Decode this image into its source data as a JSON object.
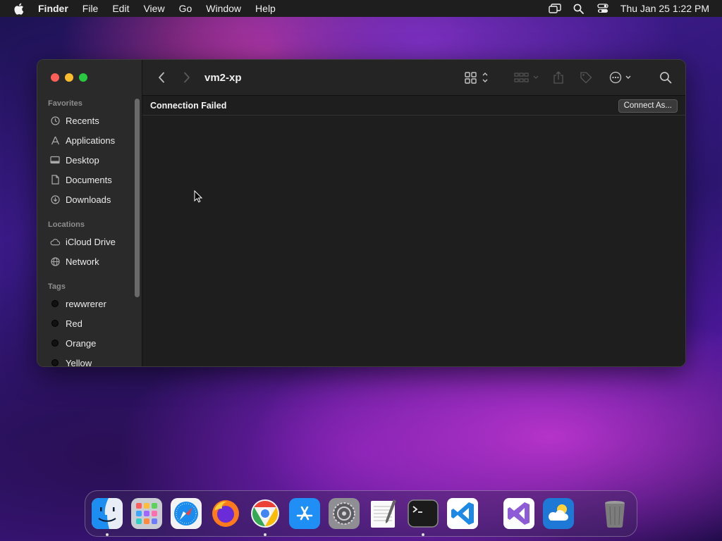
{
  "menubar": {
    "app_name": "Finder",
    "menus": [
      "File",
      "Edit",
      "View",
      "Go",
      "Window",
      "Help"
    ],
    "clock": "Thu Jan 25  1:22 PM"
  },
  "window": {
    "title": "vm2-xp",
    "banner_text": "Connection Failed",
    "connect_button": "Connect As..."
  },
  "sidebar": {
    "favorites_heading": "Favorites",
    "favorites": [
      {
        "label": "Recents",
        "icon": "clock-icon"
      },
      {
        "label": "Applications",
        "icon": "applications-icon"
      },
      {
        "label": "Desktop",
        "icon": "desktop-icon"
      },
      {
        "label": "Documents",
        "icon": "document-icon"
      },
      {
        "label": "Downloads",
        "icon": "downloads-icon"
      }
    ],
    "locations_heading": "Locations",
    "locations": [
      {
        "label": "iCloud Drive",
        "icon": "cloud-icon"
      },
      {
        "label": "Network",
        "icon": "network-globe-icon"
      }
    ],
    "tags_heading": "Tags",
    "tags": [
      {
        "label": "rewwrerer",
        "color": "#111111"
      },
      {
        "label": "Red",
        "color": "#111111"
      },
      {
        "label": "Orange",
        "color": "#111111"
      },
      {
        "label": "Yellow",
        "color": "#111111"
      }
    ]
  },
  "dock": {
    "apps": [
      {
        "name": "Finder",
        "icon": "finder-icon",
        "running": true
      },
      {
        "name": "Launchpad",
        "icon": "launchpad-icon",
        "running": false
      },
      {
        "name": "Safari",
        "icon": "safari-icon",
        "running": false
      },
      {
        "name": "Firefox",
        "icon": "firefox-icon",
        "running": false
      },
      {
        "name": "Google Chrome",
        "icon": "chrome-icon",
        "running": true
      },
      {
        "name": "App Store",
        "icon": "app-store-icon",
        "running": false
      },
      {
        "name": "System Preferences",
        "icon": "system-preferences-icon",
        "running": false
      },
      {
        "name": "TextEdit",
        "icon": "textedit-icon",
        "running": false
      },
      {
        "name": "Terminal",
        "icon": "terminal-icon",
        "running": true
      },
      {
        "name": "Visual Studio Code",
        "icon": "vscode-icon",
        "running": false
      },
      {
        "name": "Visual Studio",
        "icon": "visual-studio-icon",
        "running": false
      },
      {
        "name": "Weather",
        "icon": "weather-icon",
        "running": false
      },
      {
        "name": "Trash",
        "icon": "trash-icon",
        "running": false
      }
    ]
  },
  "colors": {
    "close": "#fe5f57",
    "minimize": "#febc2e",
    "zoom": "#28c840"
  }
}
